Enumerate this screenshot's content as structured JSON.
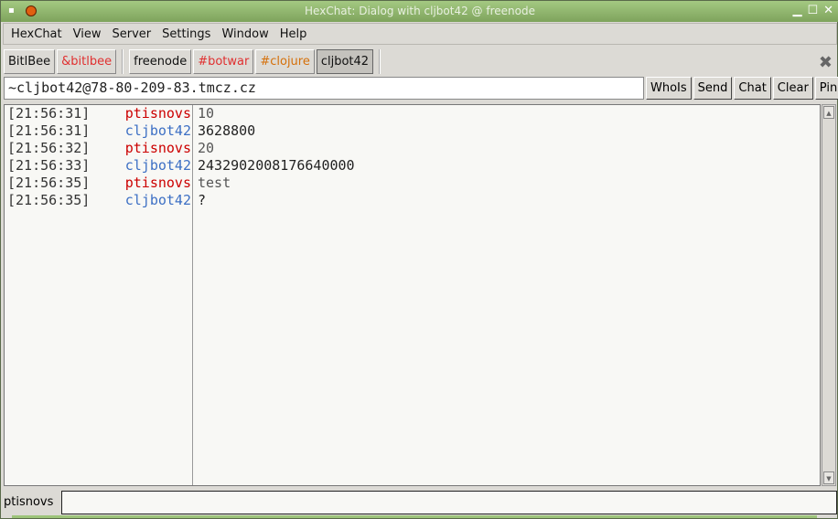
{
  "window": {
    "title": "HexChat: Dialog with cljbot42 @ freenode",
    "sys": "▪",
    "min": "▁",
    "max": "☐",
    "close": "✕"
  },
  "menu": [
    "HexChat",
    "View",
    "Server",
    "Settings",
    "Window",
    "Help"
  ],
  "tabs": [
    {
      "label": "BitlBee",
      "color": "#111111"
    },
    {
      "label": "&bitlbee",
      "color": "#e03030"
    },
    {
      "label": "freenode",
      "color": "#111111"
    },
    {
      "label": "#botwar",
      "color": "#e03030"
    },
    {
      "label": "#clojure",
      "color": "#d5700a"
    },
    {
      "label": "cljbot42",
      "color": "#111111"
    }
  ],
  "topic": "~cljbot42@78-80-209-83.tmcz.cz",
  "buttons": [
    "WhoIs",
    "Send",
    "Chat",
    "Clear",
    "Ping"
  ],
  "colors": {
    "ptisnovs": "#cc0000",
    "cljbot42": "#3c6fc4",
    "msg_user": "#555555",
    "msg_bot": "#222222"
  },
  "messages": [
    {
      "time": "[21:56:31]",
      "nick": "ptisnovs",
      "text": "10"
    },
    {
      "time": "[21:56:31]",
      "nick": "cljbot42",
      "text": "3628800"
    },
    {
      "time": "[21:56:32]",
      "nick": "ptisnovs",
      "text": "20"
    },
    {
      "time": "[21:56:33]",
      "nick": "cljbot42",
      "text": "2432902008176640000"
    },
    {
      "time": "[21:56:35]",
      "nick": "ptisnovs",
      "text": "test"
    },
    {
      "time": "[21:56:35]",
      "nick": "cljbot42",
      "text": "?"
    }
  ],
  "input": {
    "nick": "ptisnovs",
    "value": ""
  }
}
